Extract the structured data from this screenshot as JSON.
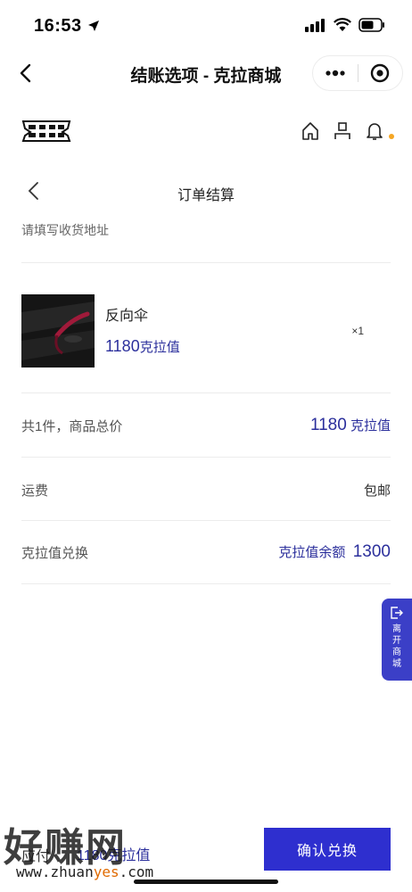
{
  "status": {
    "time": "16:53"
  },
  "nav": {
    "title": "结账选项 - 克拉商城"
  },
  "page": {
    "title": "订单结算"
  },
  "address": {
    "placeholder": "请填写收货地址"
  },
  "product": {
    "name": "反向伞",
    "price": "1180",
    "unit": "克拉值",
    "qty": "×1"
  },
  "summary": {
    "total_label": "共1件，商品总价",
    "total_value": "1180",
    "total_unit": "克拉值",
    "shipping_label": "运费",
    "shipping_value": "包邮",
    "exchange_label": "克拉值兑换",
    "balance_label": "克拉值余额",
    "balance_value": "1300"
  },
  "leave_tab": {
    "label": "离开商城"
  },
  "bottom": {
    "pay_label": "应付",
    "pay_amount": "1180克拉值",
    "confirm_label": "确认兑换"
  },
  "watermark": {
    "text_cn": "好赚网",
    "url_pre": "www.zhuan",
    "url_hl": "yes",
    "url_post": ".com"
  },
  "colors": {
    "accent": "#2b2f9c",
    "button": "#2e2fcf",
    "notif": "#f5a623"
  }
}
